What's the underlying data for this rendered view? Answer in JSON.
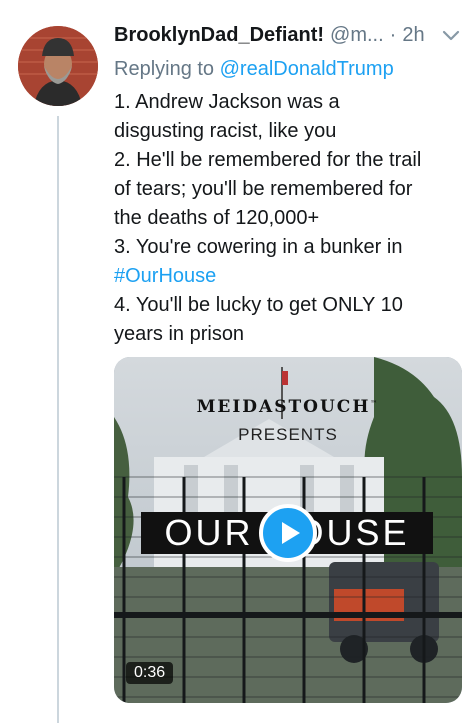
{
  "tweet": {
    "name": "BrooklynDad_Defiant!",
    "handle": "@m...",
    "separator": "·",
    "time": "2h",
    "replying_prefix": "Replying to ",
    "replying_to": "@realDonaldTrump",
    "lines": [
      "1. Andrew Jackson was a",
      "disgusting racist, like you",
      "2. He'll be remembered for the trail",
      "of tears; you'll be remembered for",
      "the deaths of 120,000+",
      "3. You're cowering in a bunker in"
    ],
    "hashtag": "#OurHouse",
    "lines_after": [
      "4. You'll be lucky to get ONLY 10",
      "years in prison"
    ]
  },
  "media": {
    "brand": "MEIDASTOUCH",
    "trademark": "™",
    "presents": "PRESENTS",
    "title": "OUR HOUSE",
    "duration": "0:36"
  },
  "icons": {
    "chevron": "chevron-down-icon",
    "play": "play-icon"
  },
  "colors": {
    "link": "#1da1f2",
    "secondary_text": "#657786"
  }
}
